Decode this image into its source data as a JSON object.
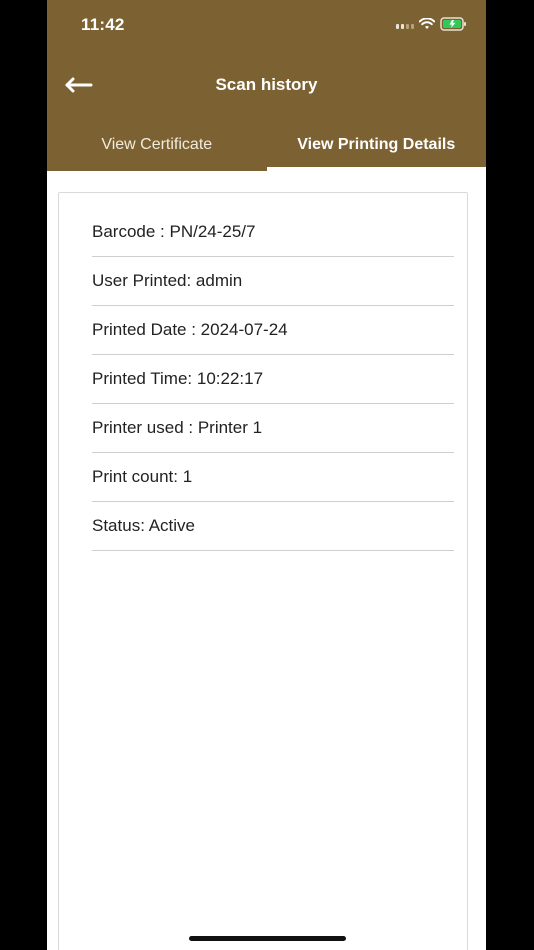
{
  "status_bar": {
    "time": "11:42",
    "icons": [
      "signal-icon",
      "wifi-icon",
      "battery-charging-icon"
    ]
  },
  "header": {
    "title": "Scan history",
    "back_icon": "arrow-left-icon"
  },
  "tabs": [
    {
      "label": "View Certificate",
      "active": false
    },
    {
      "label": "View Printing Details",
      "active": true
    }
  ],
  "details": [
    "Barcode : PN/24-25/7",
    "User Printed: admin",
    "Printed Date : 2024-07-24",
    "Printed Time: 10:22:17",
    "Printer used : Printer 1",
    "Print count: 1",
    "Status: Active"
  ],
  "colors": {
    "primary": "#7c6133",
    "background": "#ffffff",
    "side_background": "#000000",
    "divider": "#cfcfcf",
    "battery_fill": "#34c759"
  }
}
